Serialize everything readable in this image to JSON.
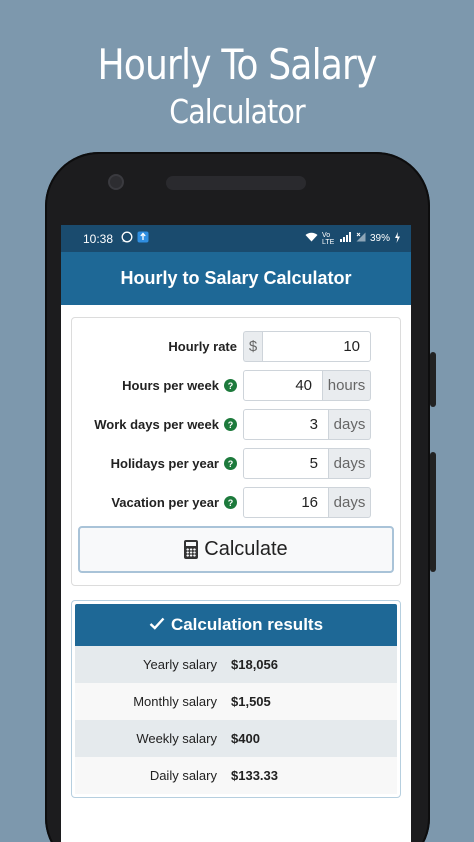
{
  "promo": {
    "line1": "Hourly To Salary",
    "line2": "Calculator"
  },
  "status_bar": {
    "time": "10:38",
    "battery": "39%",
    "signal_text": "Vo LTE"
  },
  "app_bar": {
    "title": "Hourly to Salary Calculator"
  },
  "form": {
    "hourly_rate": {
      "label": "Hourly rate",
      "prefix": "$",
      "value": "10"
    },
    "hours_per_week": {
      "label": "Hours per week",
      "value": "40",
      "suffix": "hours"
    },
    "work_days_per_week": {
      "label": "Work days per week",
      "value": "3",
      "suffix": "days"
    },
    "holidays_per_year": {
      "label": "Holidays per year",
      "value": "5",
      "suffix": "days"
    },
    "vacation_per_year": {
      "label": "Vacation per year",
      "value": "16",
      "suffix": "days"
    },
    "help_glyph": "?",
    "calculate_label": "Calculate"
  },
  "results": {
    "title": "Calculation results",
    "rows": [
      {
        "label": "Yearly salary",
        "value": "$18,056"
      },
      {
        "label": "Monthly salary",
        "value": "$1,505"
      },
      {
        "label": "Weekly salary",
        "value": "$400"
      },
      {
        "label": "Daily salary",
        "value": "$133.33"
      }
    ]
  },
  "colors": {
    "background": "#7d98ad",
    "status_bar": "#1a4b6e",
    "app_bar": "#1e6896",
    "help_icon": "#1d7a3c"
  },
  "icons": [
    "whatsapp-icon",
    "app-notification-icon",
    "wifi-icon",
    "signal-icon",
    "battery-icon",
    "help-icon",
    "calculator-icon",
    "check-icon"
  ]
}
